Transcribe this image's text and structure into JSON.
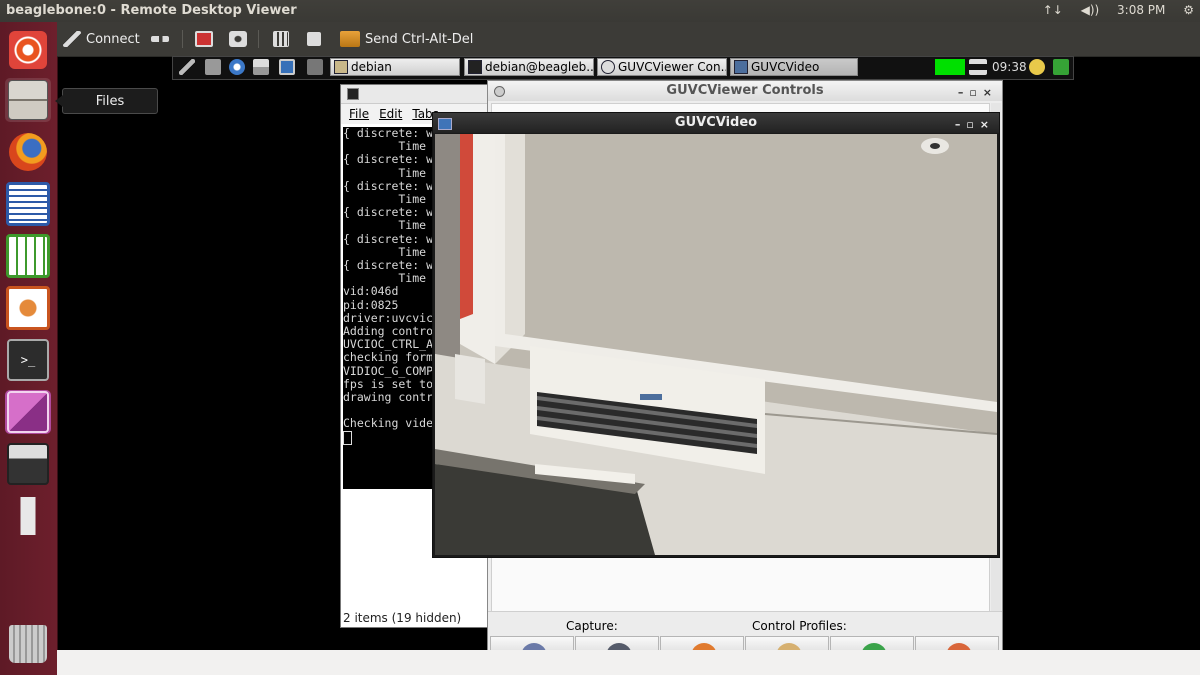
{
  "top_panel": {
    "title": "beaglebone:0 - Remote Desktop Viewer",
    "time": "3:08 PM",
    "network_icon": "↑↓",
    "volume_icon": "◀))",
    "settings_icon": "⚙"
  },
  "toolbar": {
    "connect_label": "Connect",
    "send_label": "Send Ctrl-Alt-Del"
  },
  "launcher": {
    "files_tooltip": "Files",
    "items": [
      "dash",
      "files",
      "firefox",
      "writer",
      "calc",
      "impress",
      "terminal",
      "remote-desktop",
      "save",
      "usb",
      "trash"
    ]
  },
  "remote_panel": {
    "tasks": [
      {
        "label": "debian"
      },
      {
        "label": "debian@beagleb..."
      },
      {
        "label": "GUVCViewer Con..."
      },
      {
        "label": "GUVCVideo"
      }
    ],
    "clock": "09:38"
  },
  "terminal": {
    "menu": [
      "File",
      "Edit",
      "Tabs"
    ],
    "lines": [
      "{ discrete: w",
      "        Time",
      "{ discrete: w",
      "        Time",
      "{ discrete: w",
      "        Time",
      "{ discrete: w",
      "        Time",
      "{ discrete: w",
      "        Time",
      "{ discrete: w",
      "        Time",
      "vid:046d",
      "pid:0825",
      "driver:uvcvic",
      "Adding contro",
      "UVCIOC_CTRL_A",
      "checking form",
      "VIDIOC_G_COMP",
      "fps is set to",
      "drawing contr",
      "",
      "Checking vide"
    ],
    "status": "2 items (19 hidden)"
  },
  "controls": {
    "title": "GUVCViewer Controls",
    "capture_label": "Capture:",
    "profiles_label": "Control Profiles:",
    "buttons": [
      "#6b7aa8",
      "#555b6a",
      "#e07a2e",
      "#d6b070",
      "#3aa34a",
      "#d9663a"
    ]
  },
  "video": {
    "title": "GUVCVideo"
  },
  "colors": {
    "launcher_bg": "#6d1f2c",
    "panel_bg": "#3c3b37",
    "tray_green": "#00e000"
  }
}
